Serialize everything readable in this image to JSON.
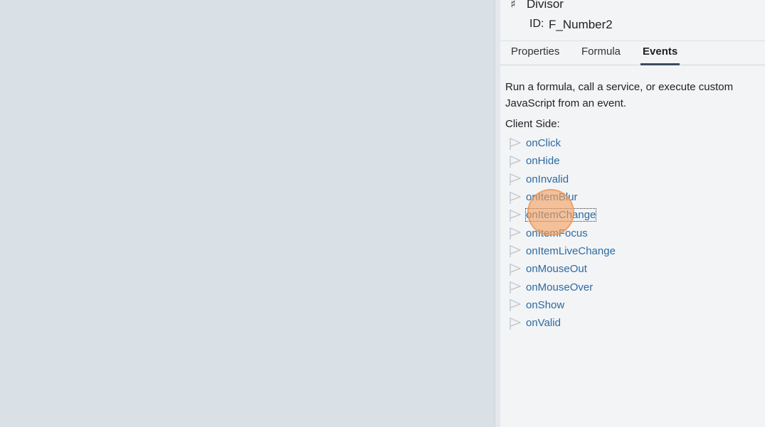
{
  "header": {
    "type_icon": "number-sign-icon",
    "field_name": "Divisor",
    "id_label": "ID:",
    "id_value": "F_Number2"
  },
  "tabs": [
    {
      "label": "Properties",
      "active": false
    },
    {
      "label": "Formula",
      "active": false
    },
    {
      "label": "Events",
      "active": true
    }
  ],
  "events_panel": {
    "description": "Run a formula, call a service, or execute custom JavaScript from an event.",
    "section_label": "Client Side:",
    "events": [
      {
        "label": "onClick",
        "icon": "flag-icon"
      },
      {
        "label": "onHide",
        "icon": "flag-icon"
      },
      {
        "label": "onInvalid",
        "icon": "flag-icon"
      },
      {
        "label": "onItemBlur",
        "icon": "flag-icon"
      },
      {
        "label": "onItemChange",
        "icon": "flag-icon",
        "focused": true
      },
      {
        "label": "onItemFocus",
        "icon": "flag-icon"
      },
      {
        "label": "onItemLiveChange",
        "icon": "flag-icon"
      },
      {
        "label": "onMouseOut",
        "icon": "flag-icon"
      },
      {
        "label": "onMouseOver",
        "icon": "flag-icon"
      },
      {
        "label": "onShow",
        "icon": "flag-icon"
      },
      {
        "label": "onValid",
        "icon": "flag-icon"
      }
    ]
  },
  "colors": {
    "canvas_bg": "#d9e0e6",
    "panel_bg": "#f3f4f6",
    "link": "#2c6aa3",
    "tab_active_underline": "#3c4c5e",
    "click_indicator": "#f4a060"
  }
}
